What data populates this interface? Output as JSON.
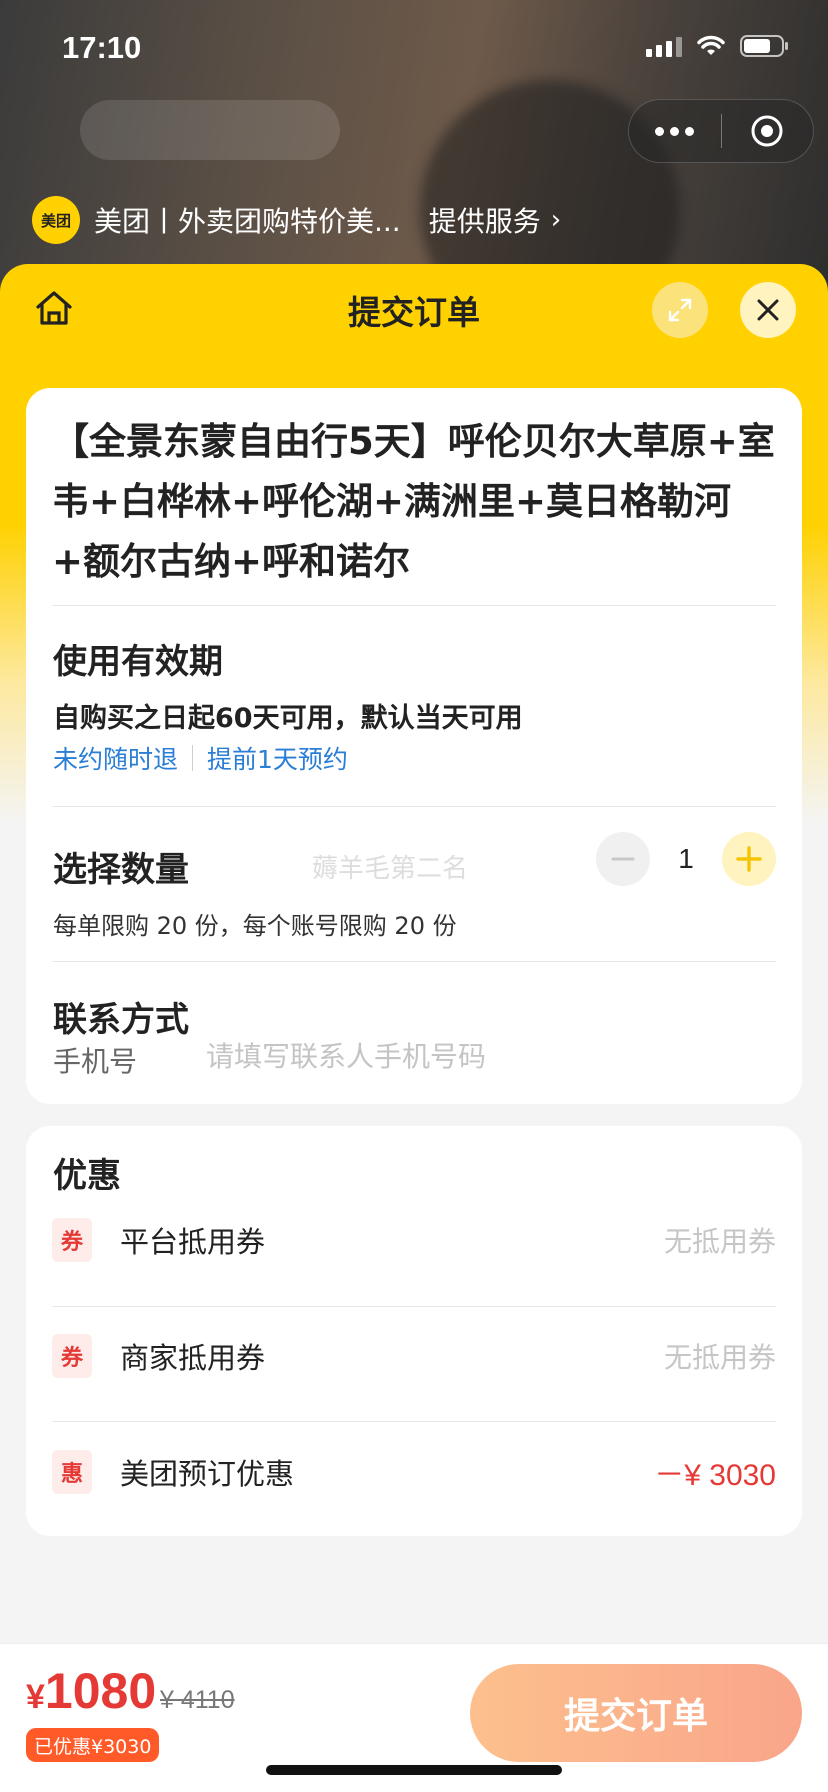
{
  "status_bar": {
    "time": "17:10"
  },
  "provider": {
    "logo_text": "美团",
    "name": "美团丨外卖团购特价美...",
    "service": "提供服务",
    "chevron": "›"
  },
  "header": {
    "title": "提交订单"
  },
  "product": {
    "title": "【全景东蒙自由行5天】呼伦贝尔大草原+室韦+白桦林+呼伦湖+满洲里+莫日格勒河+额尔古纳+呼和诺尔"
  },
  "validity": {
    "title": "使用有效期",
    "text": "自购买之日起60天可用，默认当天可用",
    "tags": [
      "未约随时退",
      "提前1天预约"
    ]
  },
  "quantity": {
    "title": "选择数量",
    "value": "1",
    "limit": "每单限购 20 份，每个账号限购 20 份",
    "watermark": "薅羊毛第二名"
  },
  "contact": {
    "title": "联系方式",
    "phone_label": "手机号",
    "phone_value": "",
    "phone_placeholder": "请填写联系人手机号码"
  },
  "discounts": {
    "title": "优惠",
    "items": [
      {
        "tag": "券",
        "label": "平台抵用券",
        "value": "无抵用券"
      },
      {
        "tag": "券",
        "label": "商家抵用券",
        "value": "无抵用券"
      },
      {
        "tag": "惠",
        "label": "美团预订优惠",
        "value": "－¥ 3030"
      }
    ]
  },
  "footer": {
    "currency": "¥",
    "price": "1080",
    "original_price": "¥ 4110",
    "saved": "已优惠¥3030",
    "submit_label": "提交订单"
  },
  "colors": {
    "accent": "#ffd100",
    "price_red": "#e53935",
    "link_blue": "#2a7ed6",
    "submit_from": "#fdc08d",
    "submit_to": "#f9a58a"
  }
}
